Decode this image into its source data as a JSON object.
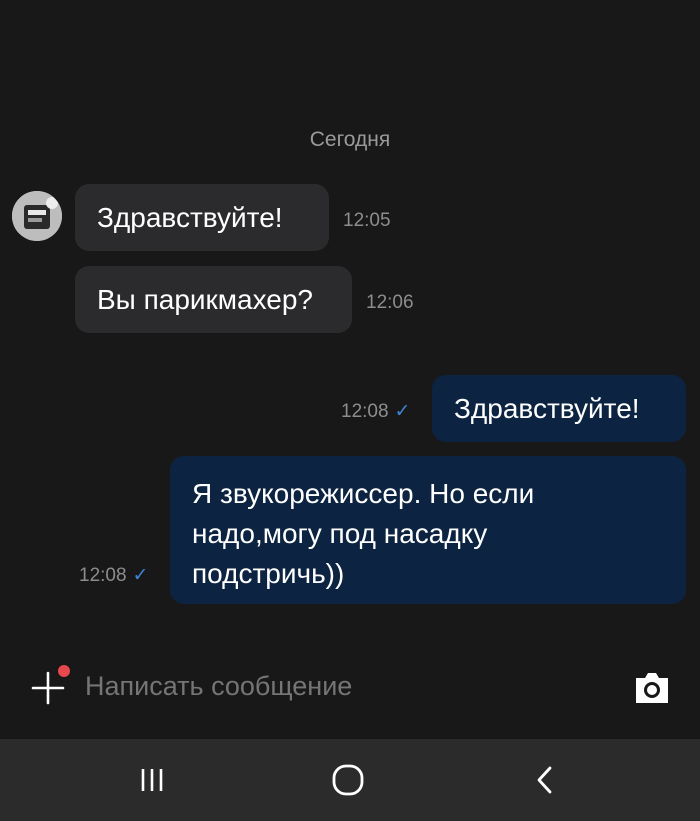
{
  "chat": {
    "date_separator": "Сегодня",
    "messages": [
      {
        "direction": "in",
        "text": "Здравствуйте!",
        "time": "12:05"
      },
      {
        "direction": "in",
        "text": "Вы парикмахер?",
        "time": "12:06"
      },
      {
        "direction": "out",
        "text": "Здравствуйте!",
        "time": "12:08",
        "status": "sent-check"
      },
      {
        "direction": "out",
        "lines": [
          "Я звукорежиссер. Но если",
          "надо,могу под насадку",
          "подстричь))"
        ],
        "time": "12:08",
        "status": "sent-check"
      }
    ]
  },
  "composer": {
    "placeholder": "Написать сообщение",
    "attach_icon": "plus-icon",
    "notification_dot_color": "#e5484d",
    "camera_icon": "camera-icon"
  },
  "navbar": {
    "buttons": [
      "recent-apps-icon",
      "home-icon",
      "back-icon"
    ]
  },
  "colors": {
    "background": "#181818",
    "incoming_bubble": "#2b2b2d",
    "outgoing_bubble": "#0c2442",
    "check": "#3d84d6"
  }
}
